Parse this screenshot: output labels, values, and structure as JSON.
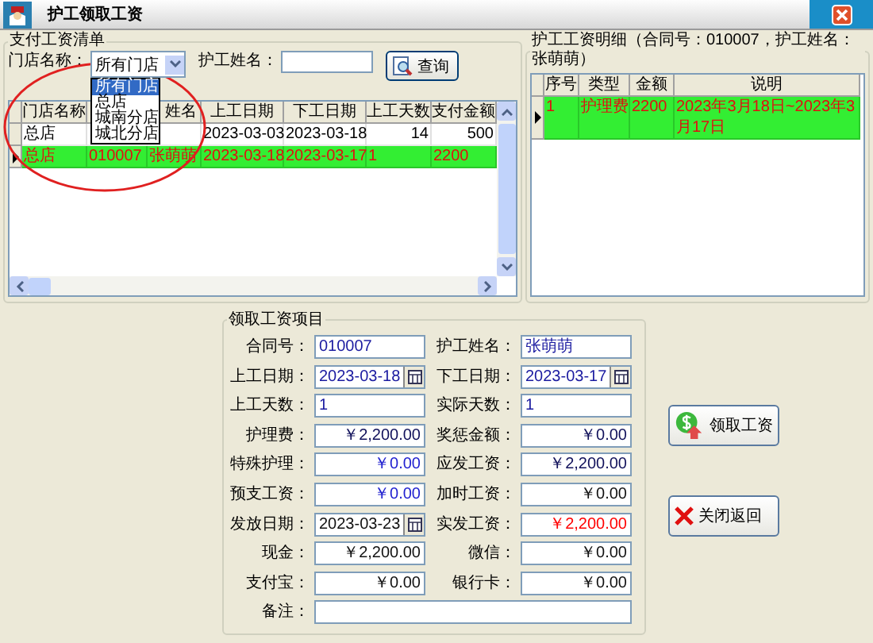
{
  "window": {
    "title": "护工领取工资"
  },
  "pay_list": {
    "title": "支付工资清单",
    "store_label": "门店名称：",
    "store_select": {
      "value": "所有门店",
      "open": true,
      "options": [
        {
          "label": "所有门店",
          "selected": true
        },
        {
          "label": "总店",
          "selected": false
        },
        {
          "label": "城南分店",
          "selected": false
        },
        {
          "label": "城北分店",
          "selected": false
        }
      ]
    },
    "name_label": "护工姓名：",
    "query_button": "查询",
    "columns": [
      {
        "label": "门店名称"
      },
      {},
      {
        "label": "姓名"
      },
      {
        "label": "上工日期"
      },
      {
        "label": "下工日期"
      },
      {
        "label": "上工天数"
      },
      {
        "label": "支付金额"
      }
    ],
    "rows": [
      {
        "selected": false,
        "cells": [
          "总店",
          null,
          null,
          "2023-03-03",
          "2023-03-18",
          "14",
          "500"
        ]
      },
      {
        "selected": true,
        "cells": [
          "总店",
          "010007",
          "张萌萌",
          "2023-03-18",
          "2023-03-17",
          "1",
          "2200"
        ]
      }
    ]
  },
  "detail": {
    "title": "护工工资明细（合同号：010007，护工姓名：张萌萌）",
    "columns": [
      "序号",
      "类型",
      "金额",
      "说明"
    ],
    "rows": [
      {
        "selected": true,
        "cells": [
          "1",
          "护理费",
          "2200",
          "2023年3月18日~2023年3月17日"
        ]
      }
    ]
  },
  "form": {
    "title": "领取工资项目",
    "fields": [
      {
        "label": "合同号：",
        "value": "010007",
        "kind": "text",
        "color": "#1a1aa0"
      },
      {
        "label": "护工姓名：",
        "value": "张萌萌",
        "kind": "text",
        "color": "#1a1aa0"
      },
      {
        "label": "上工日期：",
        "value": "2023-03-18",
        "kind": "date",
        "color": "#1a1aa0"
      },
      {
        "label": "下工日期：",
        "value": "2023-03-17",
        "kind": "date",
        "color": "#1a1aa0"
      },
      {
        "label": "上工天数：",
        "value": "1",
        "kind": "text",
        "color": "#1a1aa0"
      },
      {
        "label": "实际天数：",
        "value": "1",
        "kind": "text",
        "color": "#1a1aa0"
      },
      {
        "label": "护理费：",
        "value": "￥2,200.00",
        "kind": "money",
        "color": "#10105a"
      },
      {
        "label": "奖惩金额：",
        "value": "￥0.00",
        "kind": "money",
        "color": "#10105a"
      },
      {
        "label": "特殊护理：",
        "value": "￥0.00",
        "kind": "money",
        "color": "#2020d0"
      },
      {
        "label": "应发工资：",
        "value": "￥2,200.00",
        "kind": "money",
        "color": "#10105a"
      },
      {
        "label": "预支工资：",
        "value": "￥0.00",
        "kind": "money",
        "color": "#2020d0"
      },
      {
        "label": "加时工资：",
        "value": "￥0.00",
        "kind": "money",
        "color": "#101010"
      },
      {
        "label": "发放日期：",
        "value": "2023-03-23",
        "kind": "date",
        "color": "#101010"
      },
      {
        "label": "实发工资：",
        "value": "￥2,200.00",
        "kind": "money",
        "color": "#ff0000"
      },
      {
        "label": "现金：",
        "value": "￥2,200.00",
        "kind": "money",
        "color": "#101010"
      },
      {
        "label": "微信：",
        "value": "￥0.00",
        "kind": "money",
        "color": "#101010"
      },
      {
        "label": "支付宝：",
        "value": "￥0.00",
        "kind": "money",
        "color": "#101010"
      },
      {
        "label": "银行卡：",
        "value": "￥0.00",
        "kind": "money",
        "color": "#101010"
      },
      {
        "label": "备注：",
        "kind": "wide"
      }
    ]
  },
  "buttons": [
    {
      "label": "领取工资",
      "kind": "receive"
    },
    {
      "label": "关闭返回",
      "kind": "close"
    }
  ]
}
